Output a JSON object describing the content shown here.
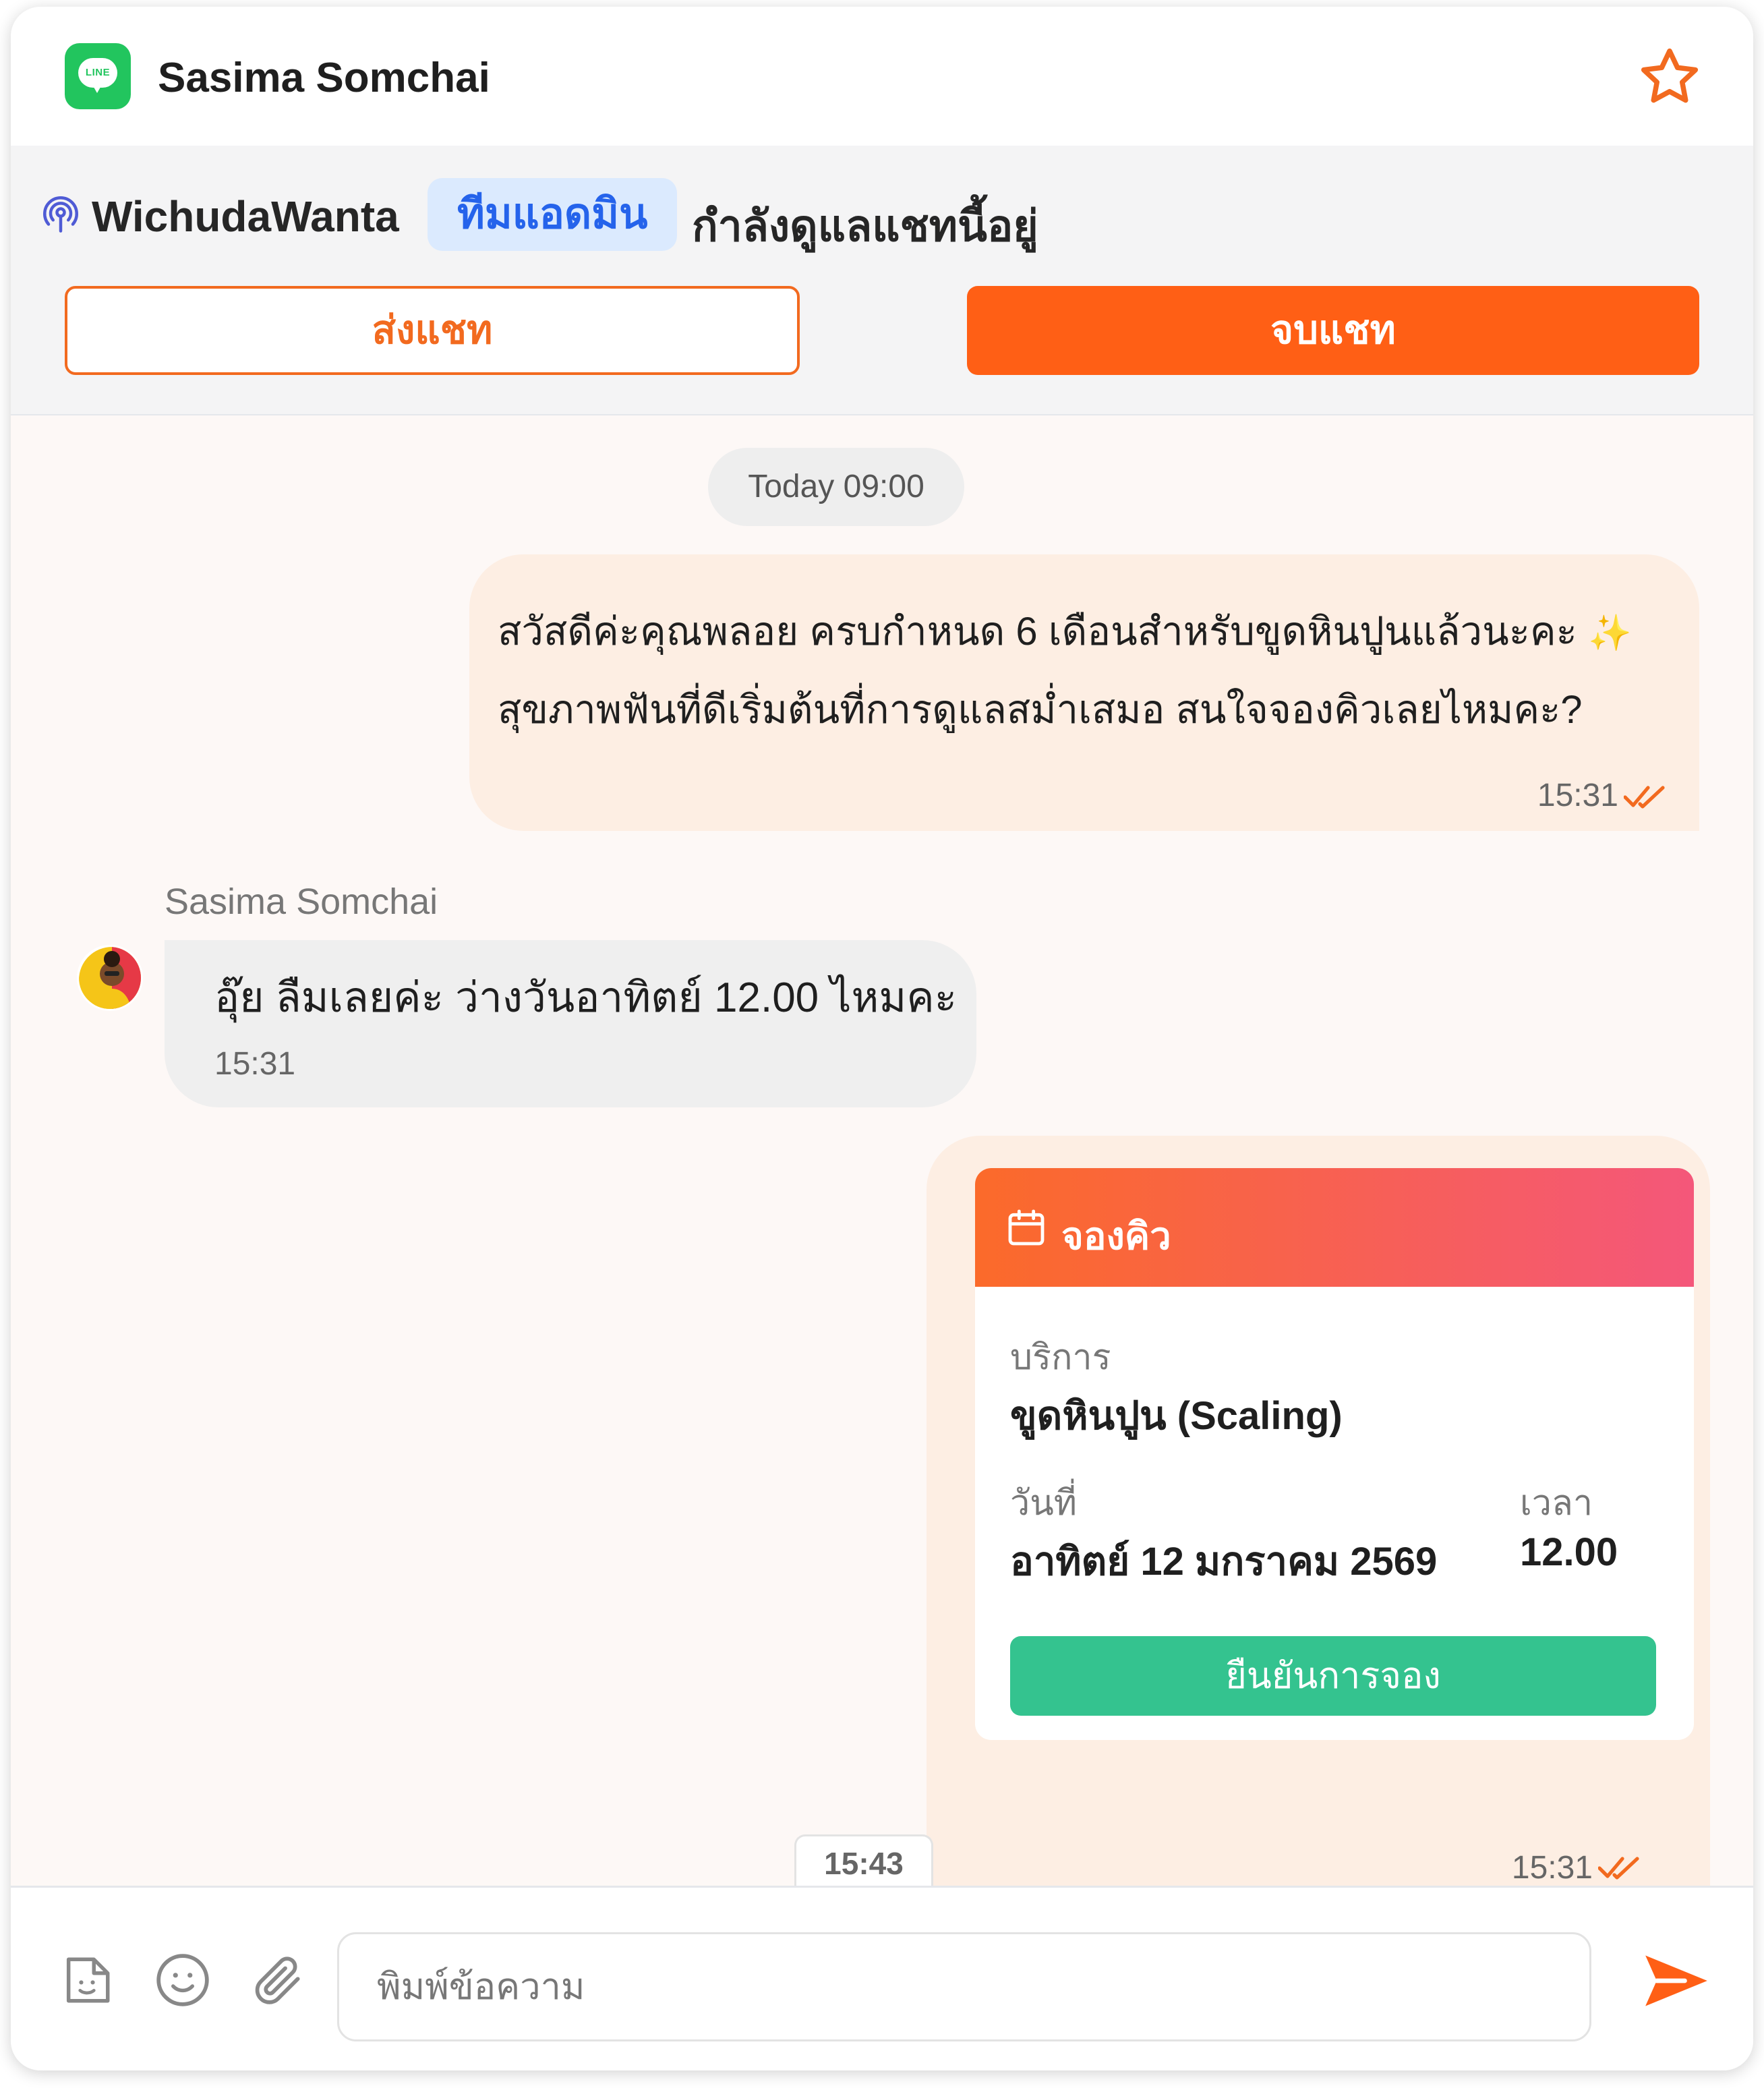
{
  "header": {
    "logo_text": "LINE",
    "contact_name": "Sasima Somchai"
  },
  "agent_bar": {
    "agent_name": "WichudaWanta",
    "team_label": "ทีมแอดมิน",
    "status_text": "กำลังดูแลแชทนี้อยู่",
    "send_chat_label": "ส่งแชท",
    "end_chat_label": "จบแชท"
  },
  "chat": {
    "date_chip": "Today 09:00",
    "outgoing_message": {
      "line1": "สวัสดีค่ะคุณพลอย ครบกำหนด 6 เดือนสำหรับขูดหินปูนแล้วนะคะ",
      "sparkle": "✨",
      "line2": "สุขภาพฟันที่ดีเริ่มต้นที่การดูแลสม่ำเสมอ สนใจจองคิวเลยไหมคะ?",
      "time": "15:31"
    },
    "incoming_message": {
      "sender": "Sasima Somchai",
      "text": "อุ๊ย ลืมเลยค่ะ ว่างวันอาทิตย์ 12.00 ไหมคะ",
      "time": "15:31"
    },
    "booking_card": {
      "title": "จองคิว",
      "service_label": "บริการ",
      "service_value": "ขูดหินปูน (Scaling)",
      "date_label": "วันที่",
      "date_value": "อาทิตย์ 12 มกราคม 2569",
      "time_label": "เวลา",
      "time_value": "12.00",
      "confirm_label": "ยืนยันการจอง",
      "sent_time": "15:31"
    },
    "time_tab": "15:43"
  },
  "composer": {
    "placeholder": "พิมพ์ข้อความ"
  },
  "colors": {
    "accent": "#ff5f15",
    "line_green": "#22c55e",
    "confirm_green": "#34c38f",
    "team_pill_bg": "#dbeafe",
    "team_pill_text": "#2563eb"
  }
}
